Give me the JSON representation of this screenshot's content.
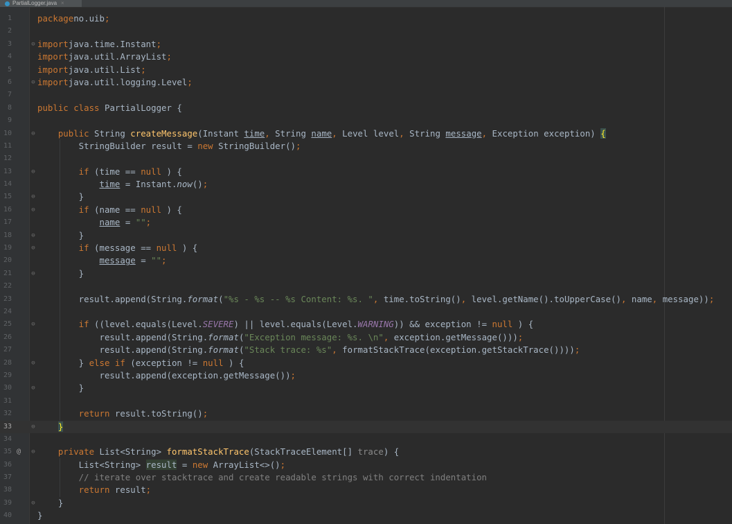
{
  "tab": {
    "filename": "PartialLogger.java",
    "close": "×",
    "icon": "java-class-icon",
    "icon_color": "#3592c4"
  },
  "gutter": {
    "override_marker": "@"
  },
  "current_line": 33,
  "lines": [
    {
      "n": "1",
      "ind": 0,
      "toks": [
        [
          "kw",
          "package"
        ],
        [
          "",
          "no.uib"
        ],
        [
          "kw",
          ";"
        ]
      ]
    },
    {
      "n": "2",
      "ind": 0,
      "toks": []
    },
    {
      "n": "3",
      "ind": 0,
      "fold": "⊖",
      "toks": [
        [
          "kw",
          "import"
        ],
        [
          "",
          "java.time.Instant"
        ],
        [
          "kw",
          ";"
        ]
      ]
    },
    {
      "n": "4",
      "ind": 0,
      "toks": [
        [
          "kw",
          "import"
        ],
        [
          "",
          "java.util.ArrayList"
        ],
        [
          "kw",
          ";"
        ]
      ]
    },
    {
      "n": "5",
      "ind": 0,
      "toks": [
        [
          "kw",
          "import"
        ],
        [
          "",
          "java.util.List"
        ],
        [
          "kw",
          ";"
        ]
      ]
    },
    {
      "n": "6",
      "ind": 0,
      "fold": "⊖",
      "toks": [
        [
          "kw",
          "import"
        ],
        [
          "",
          "java.util.logging.Level"
        ],
        [
          "kw",
          ";"
        ]
      ]
    },
    {
      "n": "7",
      "ind": 0,
      "toks": []
    },
    {
      "n": "8",
      "ind": 0,
      "toks": [
        [
          "kw",
          "public class"
        ],
        [
          "",
          " PartialLogger {"
        ]
      ]
    },
    {
      "n": "9",
      "ind": 0,
      "toks": []
    },
    {
      "n": "10",
      "ind": 4,
      "fold": "⊖",
      "toks": [
        [
          "kw",
          "public"
        ],
        [
          "",
          " String "
        ],
        [
          "fn",
          "createMessage"
        ],
        [
          "",
          "(Instant "
        ],
        [
          "u",
          "time"
        ],
        [
          "kw",
          ","
        ],
        [
          "",
          " String "
        ],
        [
          "u",
          "name"
        ],
        [
          "kw",
          ","
        ],
        [
          "",
          " Level level"
        ],
        [
          "kw",
          ","
        ],
        [
          "",
          " String "
        ],
        [
          "u",
          "message"
        ],
        [
          "kw",
          ","
        ],
        [
          "",
          " Exception exception) "
        ],
        [
          "hlbr",
          "{"
        ]
      ]
    },
    {
      "n": "11",
      "ind": 8,
      "toks": [
        [
          "",
          "StringBuilder result = "
        ],
        [
          "kw",
          "new"
        ],
        [
          "",
          " StringBuilder()"
        ],
        [
          "kw",
          ";"
        ]
      ]
    },
    {
      "n": "12",
      "ind": 0,
      "toks": []
    },
    {
      "n": "13",
      "ind": 8,
      "fold": "⊖",
      "toks": [
        [
          "kw",
          "if"
        ],
        [
          "",
          " (time == "
        ],
        [
          "kw",
          "null"
        ],
        [
          "",
          " ) {"
        ]
      ]
    },
    {
      "n": "14",
      "ind": 12,
      "toks": [
        [
          "u",
          "time"
        ],
        [
          "",
          " = Instant."
        ],
        [
          "it",
          "now"
        ],
        [
          "",
          "()"
        ],
        [
          "kw",
          ";"
        ]
      ]
    },
    {
      "n": "15",
      "ind": 8,
      "fold": "⊖",
      "toks": [
        [
          "",
          "}"
        ]
      ]
    },
    {
      "n": "16",
      "ind": 8,
      "fold": "⊖",
      "toks": [
        [
          "kw",
          "if"
        ],
        [
          "",
          " (name == "
        ],
        [
          "kw",
          "null"
        ],
        [
          "",
          " ) {"
        ]
      ]
    },
    {
      "n": "17",
      "ind": 12,
      "toks": [
        [
          "u",
          "name"
        ],
        [
          "",
          " = "
        ],
        [
          "str",
          "\"\""
        ],
        [
          "kw",
          ";"
        ]
      ]
    },
    {
      "n": "18",
      "ind": 8,
      "fold": "⊖",
      "toks": [
        [
          "",
          "}"
        ]
      ]
    },
    {
      "n": "19",
      "ind": 8,
      "fold": "⊖",
      "toks": [
        [
          "kw",
          "if"
        ],
        [
          "",
          " (message == "
        ],
        [
          "kw",
          "null"
        ],
        [
          "",
          " ) {"
        ]
      ]
    },
    {
      "n": "20",
      "ind": 12,
      "toks": [
        [
          "u",
          "message"
        ],
        [
          "",
          " = "
        ],
        [
          "str",
          "\"\""
        ],
        [
          "kw",
          ";"
        ]
      ]
    },
    {
      "n": "21",
      "ind": 8,
      "fold": "⊖",
      "toks": [
        [
          "",
          "}"
        ]
      ]
    },
    {
      "n": "22",
      "ind": 0,
      "toks": []
    },
    {
      "n": "23",
      "ind": 8,
      "toks": [
        [
          "",
          "result.append(String."
        ],
        [
          "it",
          "format"
        ],
        [
          "",
          "("
        ],
        [
          "str",
          "\"%s - %s -- %s Content: %s. \""
        ],
        [
          "kw",
          ","
        ],
        [
          "",
          " time.toString()"
        ],
        [
          "kw",
          ","
        ],
        [
          "",
          " level.getName().toUpperCase()"
        ],
        [
          "kw",
          ","
        ],
        [
          "",
          " name"
        ],
        [
          "kw",
          ","
        ],
        [
          "",
          " message))"
        ],
        [
          "kw",
          ";"
        ]
      ]
    },
    {
      "n": "24",
      "ind": 0,
      "toks": []
    },
    {
      "n": "25",
      "ind": 8,
      "fold": "⊖",
      "toks": [
        [
          "kw",
          "if"
        ],
        [
          "",
          " ((level.equals(Level."
        ],
        [
          "cst",
          "SEVERE"
        ],
        [
          "",
          ") || level.equals(Level."
        ],
        [
          "cst",
          "WARNING"
        ],
        [
          "",
          ")) && exception != "
        ],
        [
          "kw",
          "null"
        ],
        [
          "",
          " ) {"
        ]
      ]
    },
    {
      "n": "26",
      "ind": 12,
      "toks": [
        [
          "",
          "result.append(String."
        ],
        [
          "it",
          "format"
        ],
        [
          "",
          "("
        ],
        [
          "str",
          "\"Exception message: %s. \\n\""
        ],
        [
          "kw",
          ","
        ],
        [
          "",
          " exception.getMessage()))"
        ],
        [
          "kw",
          ";"
        ]
      ]
    },
    {
      "n": "27",
      "ind": 12,
      "toks": [
        [
          "",
          "result.append(String."
        ],
        [
          "it",
          "format"
        ],
        [
          "",
          "("
        ],
        [
          "str",
          "\"Stack trace: %s\""
        ],
        [
          "kw",
          ","
        ],
        [
          "",
          " formatStackTrace(exception.getStackTrace())))"
        ],
        [
          "kw",
          ";"
        ]
      ]
    },
    {
      "n": "28",
      "ind": 8,
      "fold": "⊖",
      "toks": [
        [
          "",
          "} "
        ],
        [
          "kw",
          "else if"
        ],
        [
          "",
          " (exception != "
        ],
        [
          "kw",
          "null"
        ],
        [
          "",
          " ) {"
        ]
      ]
    },
    {
      "n": "29",
      "ind": 12,
      "toks": [
        [
          "",
          "result.append(exception.getMessage())"
        ],
        [
          "kw",
          ";"
        ]
      ]
    },
    {
      "n": "30",
      "ind": 8,
      "fold": "⊖",
      "toks": [
        [
          "",
          "}"
        ]
      ]
    },
    {
      "n": "31",
      "ind": 0,
      "toks": []
    },
    {
      "n": "32",
      "ind": 8,
      "toks": [
        [
          "kw",
          "return"
        ],
        [
          "",
          " result.toString()"
        ],
        [
          "kw",
          ";"
        ]
      ]
    },
    {
      "n": "33",
      "ind": 4,
      "fold": "⊖",
      "toks": [
        [
          "hlbr",
          "}"
        ]
      ]
    },
    {
      "n": "34",
      "ind": 0,
      "toks": []
    },
    {
      "n": "35",
      "ind": 4,
      "fold": "⊖",
      "mark": "@",
      "toks": [
        [
          "kw",
          "private"
        ],
        [
          "",
          " List<String> "
        ],
        [
          "fn",
          "formatStackTrace"
        ],
        [
          "",
          "(StackTraceElement[] "
        ],
        [
          "dim",
          "trace"
        ],
        [
          "",
          ") {"
        ]
      ]
    },
    {
      "n": "36",
      "ind": 8,
      "toks": [
        [
          "",
          "List<String> "
        ],
        [
          "hlv",
          "result"
        ],
        [
          "",
          " = "
        ],
        [
          "kw",
          "new"
        ],
        [
          "",
          " ArrayList<>()"
        ],
        [
          "kw",
          ";"
        ]
      ]
    },
    {
      "n": "37",
      "ind": 8,
      "toks": [
        [
          "cmt",
          "// iterate over stacktrace and create readable strings with correct indentation"
        ]
      ]
    },
    {
      "n": "38",
      "ind": 8,
      "toks": [
        [
          "kw",
          "return"
        ],
        [
          "",
          " result"
        ],
        [
          "kw",
          ";"
        ]
      ]
    },
    {
      "n": "39",
      "ind": 4,
      "fold": "⊖",
      "toks": [
        [
          "",
          "}"
        ]
      ]
    },
    {
      "n": "40",
      "ind": 0,
      "toks": [
        [
          "",
          "}"
        ]
      ]
    }
  ]
}
